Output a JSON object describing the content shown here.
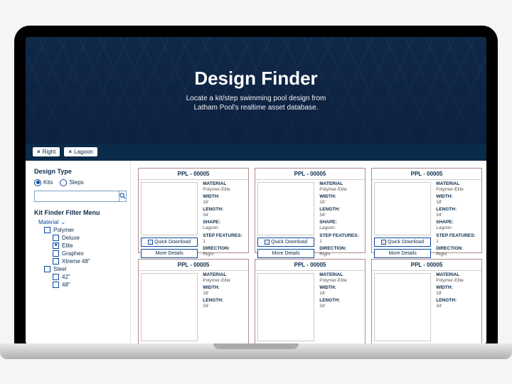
{
  "hero": {
    "title": "Design Finder",
    "subtitle": "Locate a kit/step swimming pool design from\nLatham Pool's realtime asset database."
  },
  "tags": [
    {
      "close": "×",
      "label": "Right"
    },
    {
      "close": "×",
      "label": "Lagoon"
    }
  ],
  "sidebar": {
    "designType": {
      "heading": "Design Type",
      "options": [
        {
          "label": "Kits",
          "selected": true
        },
        {
          "label": "Steps",
          "selected": false
        }
      ]
    },
    "searchPlaceholder": "",
    "filterMenuHeading": "Kit Finder Filter Menu",
    "material": {
      "label": "Material",
      "groups": [
        {
          "label": "Polymer",
          "checked": false,
          "children": [
            {
              "label": "Deluxe",
              "checked": false
            },
            {
              "label": "Elite",
              "checked": true
            },
            {
              "label": "Graphex",
              "checked": false
            },
            {
              "label": "Xtreme 48\"",
              "checked": false
            }
          ]
        },
        {
          "label": "Steel",
          "checked": false,
          "children": [
            {
              "label": "42\"",
              "checked": false
            },
            {
              "label": "48\"",
              "checked": false
            }
          ]
        }
      ]
    }
  },
  "card": {
    "title": "PPL - 00005",
    "quickDownload": "Quick Download",
    "moreDetails": "More Details",
    "specs": {
      "materialLabel": "MATERIAL",
      "material": "Polymer-Elite",
      "widthLabel": "WIDTH:",
      "width": "18'",
      "lengthLabel": "LENGTH:",
      "length": "34'",
      "shapeLabel": "SHAPE:",
      "shape": "Lagoon",
      "stepLabel": "STEP FEATURES:",
      "step": "1",
      "dirLabel": "DIRECTION:",
      "dir": "Right"
    }
  }
}
